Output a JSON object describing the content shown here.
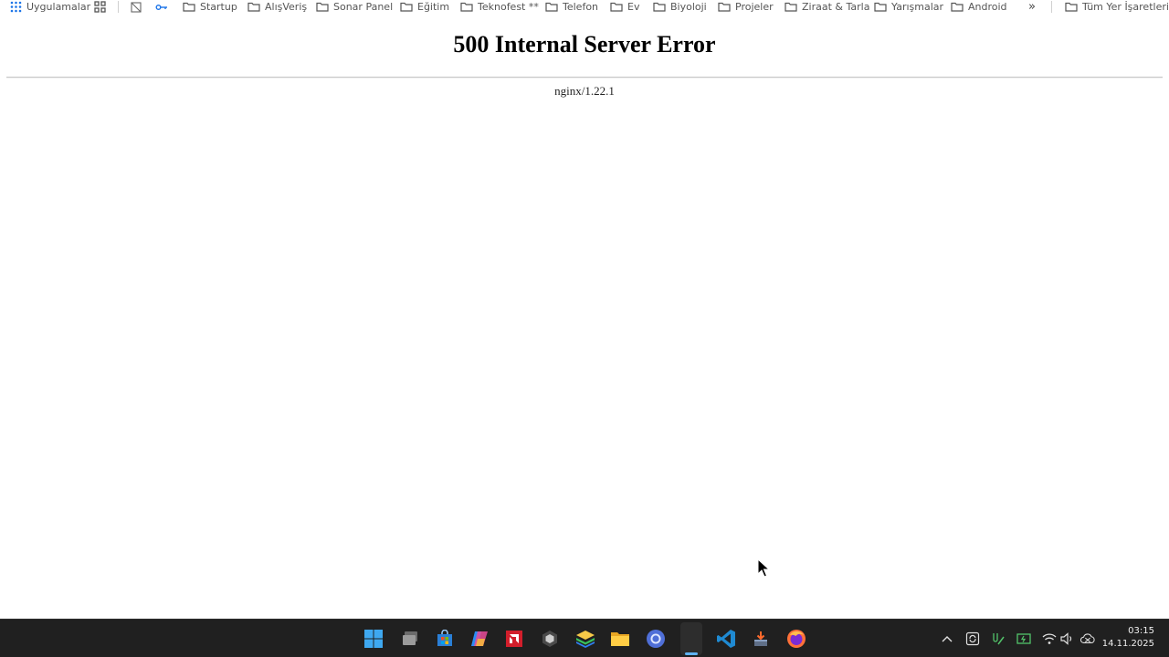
{
  "bookmarks_bar": {
    "apps_label": "Uygulamalar",
    "items": [
      {
        "label": "Startup",
        "icon": "folder-icon"
      },
      {
        "label": "AlışVeriş",
        "icon": "folder-icon"
      },
      {
        "label": "Sonar Panel",
        "icon": "folder-icon"
      },
      {
        "label": "Eğitim",
        "icon": "folder-icon"
      },
      {
        "label": "Teknofest **",
        "icon": "folder-icon"
      },
      {
        "label": "Telefon",
        "icon": "folder-icon"
      },
      {
        "label": "Ev",
        "icon": "folder-icon"
      },
      {
        "label": "Biyoloji",
        "icon": "folder-icon"
      },
      {
        "label": "Projeler",
        "icon": "folder-icon"
      },
      {
        "label": "Ziraat & Tarla",
        "icon": "folder-icon"
      },
      {
        "label": "Yarışmalar",
        "icon": "folder-icon"
      },
      {
        "label": "Android",
        "icon": "folder-icon"
      }
    ],
    "overflow_label": "»",
    "all_bookmarks_label": "Tüm Yer İşaretleri"
  },
  "page": {
    "title": "500 Internal Server Error",
    "server_signature": "nginx/1.22.1"
  },
  "taskbar": {
    "apps": [
      "start-icon",
      "task-view-icon",
      "store-icon",
      "copilot-icon",
      "amd-software-icon",
      "unity-icon",
      "bluestacks-icon",
      "file-explorer-icon",
      "chrome-icon",
      "chrome-profile-icon",
      "vscode-icon",
      "installer-icon",
      "firefox-icon"
    ],
    "active_app": "chrome-profile-icon",
    "tray": [
      "chevron-up-icon",
      "sync-icon",
      "pen-icon",
      "battery-icon",
      "wifi-icon",
      "volume-icon",
      "cloud-off-icon"
    ]
  },
  "clock": {
    "time": "03:15",
    "date": "14.11.2025"
  },
  "colors": {
    "taskbar_bg": "#202020",
    "active_indicator": "#5fb2f2",
    "folder_icon": "#555555"
  }
}
